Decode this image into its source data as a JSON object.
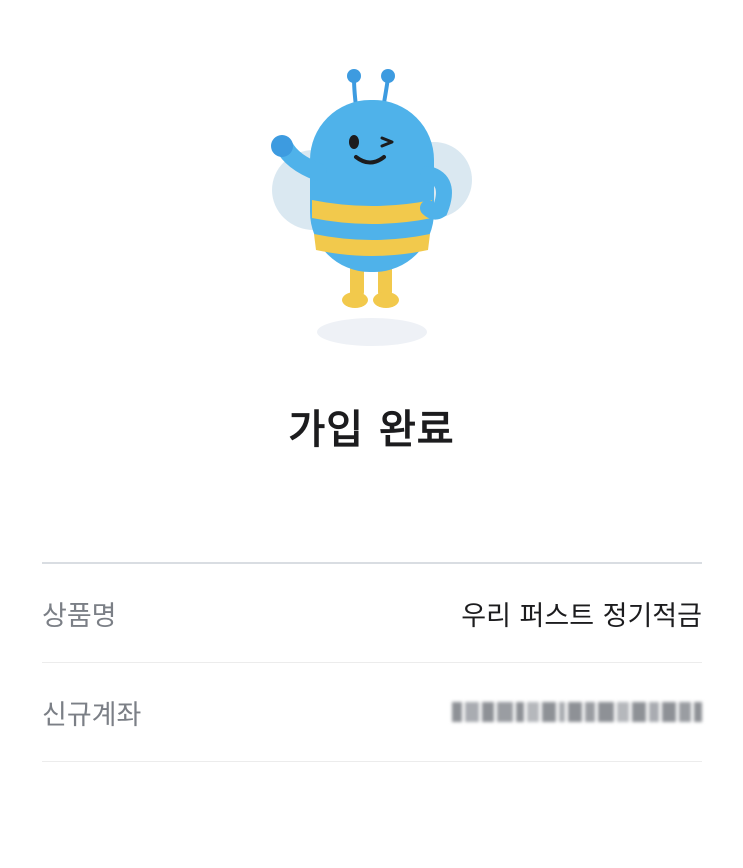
{
  "title": "가입 완료",
  "details": [
    {
      "label": "상품명",
      "value": "우리 퍼스트 정기적금"
    },
    {
      "label": "신규계좌",
      "value": "",
      "masked": true
    }
  ],
  "colors": {
    "mascot_body": "#4fb2ea",
    "mascot_stripe": "#f2c94c",
    "mascot_wing": "#d6e6f0",
    "divider": "#d9dde2",
    "label_text": "#7b7f86"
  },
  "icons": {
    "mascot": "bee-mascot-icon"
  }
}
